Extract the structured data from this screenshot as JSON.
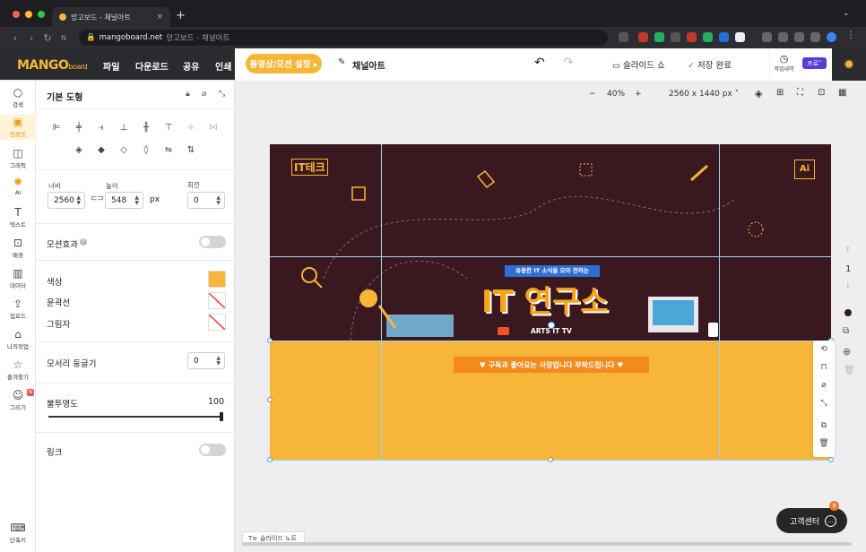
{
  "browser": {
    "tab_title": "망고보드 - 채널아트",
    "tab_close": "×",
    "new_tab": "+",
    "url_host": "mangoboard.net",
    "url_title": "망고보드 - 채널아트",
    "nav_back": "‹",
    "nav_forward": "›",
    "nav_reload": "↻"
  },
  "header": {
    "logo": "MANGO",
    "logo_sub": "board",
    "menus": [
      "파일",
      "다운로드",
      "공유",
      "인쇄"
    ],
    "motion_button": "동영상/모션 설정 ▸",
    "doc_name": "채널아트",
    "undo": "↶",
    "redo": "↷",
    "slideshow": "슬라이드 쇼",
    "save_status": "저장 완료",
    "history_label": "작업내역",
    "pro_badge": "프로˅"
  },
  "sidebar": {
    "items": [
      {
        "label": "검색",
        "icon": "○"
      },
      {
        "label": "템플릿",
        "icon": "▣"
      },
      {
        "label": "그래픽",
        "icon": "◫"
      },
      {
        "label": "AI",
        "icon": "✺"
      },
      {
        "label": "텍스트",
        "icon": "T"
      },
      {
        "label": "배경",
        "icon": "⊡"
      },
      {
        "label": "데이터",
        "icon": "▥"
      },
      {
        "label": "업로드",
        "icon": "⇪"
      },
      {
        "label": "나의작업",
        "icon": "⌂"
      },
      {
        "label": "즐겨찾기",
        "icon": "☆"
      },
      {
        "label": "그리기",
        "icon": "☺"
      }
    ],
    "new_badge": "N",
    "shortcut_label": "단축키"
  },
  "panel": {
    "title": "기본 도형",
    "width_label": "너비",
    "height_label": "높이",
    "rotate_label": "회전",
    "width_value": "2560",
    "height_value": "548",
    "rotate_value": "0",
    "unit": "px",
    "motion_label": "모션효과",
    "motion_help": "?",
    "fill_label": "색상",
    "stroke_label": "윤곽선",
    "shadow_label": "그림자",
    "radius_label": "모서리 둥글기",
    "radius_value": "0",
    "opacity_label": "불투명도",
    "opacity_value": "100",
    "link_label": "링크"
  },
  "workspace": {
    "zoom_minus": "−",
    "zoom": "40%",
    "zoom_plus": "+",
    "canvas_size": "2560 x 1440 px ˅",
    "page_number": "1",
    "slide_note": "슬라이드 노트",
    "help_center": "고객센터",
    "help_count": "8"
  },
  "canvas": {
    "logo_text": "IT테크",
    "ai_badge": "Ai",
    "ribbon": "유용한 IT 소식을 모아 전하는",
    "title": "IT 연구소",
    "channel": "ARTS IT TV",
    "banner": "♥ 구독과 좋아요는 사랑입니다 부탁드립니다 ♥"
  },
  "colors": {
    "accent": "#f7b636",
    "canvas_top": "#3a1820",
    "canvas_bottom": "#f7b63a",
    "banner": "#f28a1c",
    "pro": "#5a3dd6"
  }
}
